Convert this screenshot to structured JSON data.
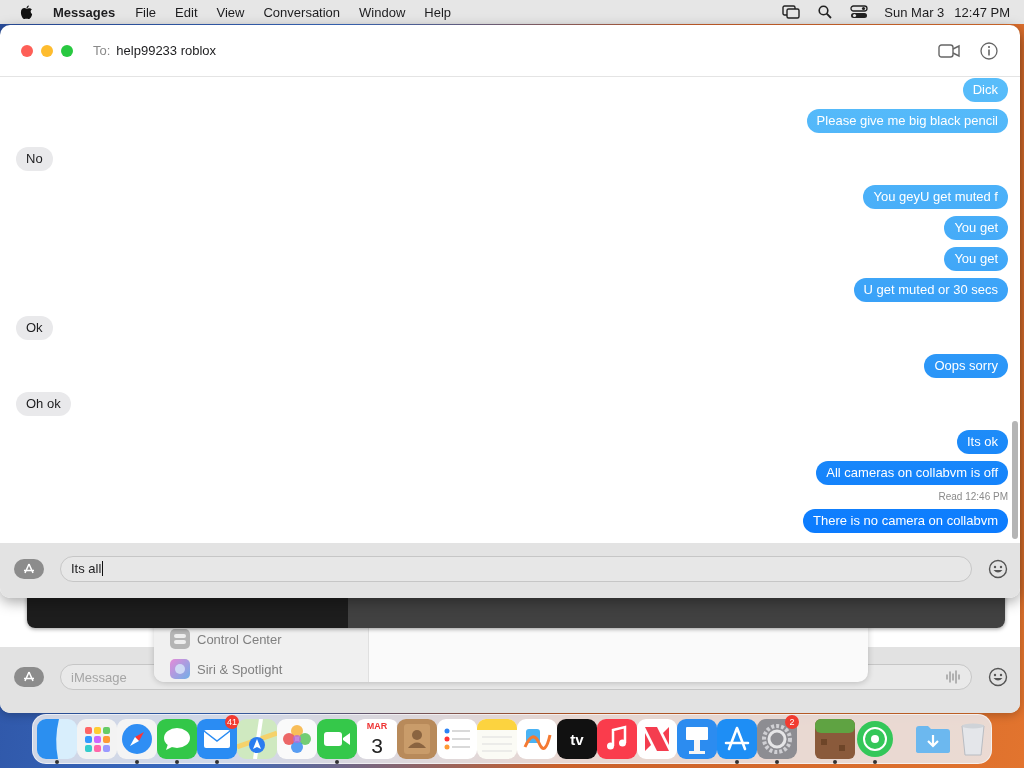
{
  "menu_bar": {
    "app": "Messages",
    "menus": [
      "File",
      "Edit",
      "View",
      "Conversation",
      "Window",
      "Help"
    ],
    "date": "Sun Mar 3",
    "time": "12:47 PM"
  },
  "window": {
    "to_label": "To:",
    "recipient": "help99233 roblox",
    "messages": [
      {
        "kind": "sent",
        "text": "Dick"
      },
      {
        "kind": "sent",
        "text": "Please give me big black pencil"
      },
      {
        "kind": "received",
        "text": "No"
      },
      {
        "kind": "sent",
        "text": "You geyU get muted f"
      },
      {
        "kind": "sent",
        "text": "You get"
      },
      {
        "kind": "sent",
        "text": "You get"
      },
      {
        "kind": "sent",
        "text": "U get muted or 30 secs"
      },
      {
        "kind": "received",
        "text": "Ok"
      },
      {
        "kind": "sent",
        "text": "Oops sorry"
      },
      {
        "kind": "received",
        "text": "Oh ok"
      },
      {
        "kind": "sent",
        "text": "Its ok"
      },
      {
        "kind": "sent",
        "text": "All cameras on collabvm is off",
        "receipt": "Read 12:46 PM"
      },
      {
        "kind": "sent",
        "text": "There is no camera on collabvm"
      }
    ],
    "composer": {
      "value": "Its all"
    }
  },
  "background_windows": {
    "settings_items": [
      {
        "kind": "control",
        "label": "Control Center"
      },
      {
        "kind": "siri",
        "label": "Siri & Spotlight"
      }
    ],
    "composer": {
      "placeholder": "iMessage"
    }
  },
  "dock": {
    "sections": [
      {
        "apps": [
          {
            "kind": "finder",
            "running": true
          },
          {
            "kind": "launchpad",
            "running": false
          },
          {
            "kind": "safari",
            "running": true
          },
          {
            "kind": "messages",
            "running": true
          },
          {
            "kind": "mail",
            "running": true,
            "badge": "41"
          },
          {
            "kind": "maps",
            "running": false
          },
          {
            "kind": "photos",
            "running": false
          },
          {
            "kind": "facetime",
            "running": true
          },
          {
            "kind": "calendar",
            "running": false,
            "month": "MAR",
            "day": "3"
          },
          {
            "kind": "contacts",
            "running": false
          },
          {
            "kind": "reminders",
            "running": false
          },
          {
            "kind": "notes",
            "running": false
          },
          {
            "kind": "freeform",
            "running": false
          },
          {
            "kind": "tv",
            "running": false,
            "label": "tv"
          },
          {
            "kind": "music",
            "running": false
          },
          {
            "kind": "news",
            "running": false
          },
          {
            "kind": "keynote",
            "running": false
          },
          {
            "kind": "appstore",
            "running": true
          },
          {
            "kind": "settings",
            "running": true,
            "badge": "2"
          }
        ]
      },
      {
        "apps": [
          {
            "kind": "minecraft",
            "running": true
          },
          {
            "kind": "findmy",
            "running": true
          }
        ]
      },
      {
        "apps": [
          {
            "kind": "downloads",
            "running": false
          },
          {
            "kind": "trash",
            "running": false
          }
        ]
      }
    ]
  }
}
